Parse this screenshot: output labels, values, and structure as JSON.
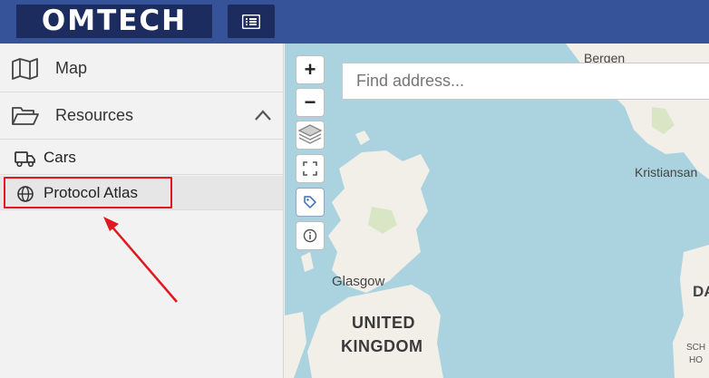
{
  "header": {
    "logo_text": "OMTECH",
    "menu_icon": "list-icon"
  },
  "sidebar": {
    "items": [
      {
        "label": "Map",
        "icon": "map-icon"
      },
      {
        "label": "Resources",
        "icon": "folder-open-icon",
        "expanded": true
      }
    ],
    "resources": [
      {
        "label": "Cars",
        "icon": "truck-icon"
      },
      {
        "label": "Protocol Atlas",
        "icon": "globe-icon",
        "highlighted": true
      }
    ]
  },
  "map": {
    "search_placeholder": "Find address...",
    "zoom_in": "+",
    "zoom_out": "−",
    "labels": {
      "glasgow": "Glasgow",
      "united": "UNITED",
      "kingdom": "KINGDOM",
      "bergen": "Bergen",
      "kristiansand": "Kristiansan",
      "da": "DA",
      "sch": "SCH",
      "ho": "HO"
    }
  },
  "annotation": {
    "color": "#e0191e"
  },
  "colors": {
    "header": "#36539a",
    "logo_bg": "#1d2c5e",
    "sea": "#aad3df",
    "land": "#f2efe9"
  }
}
